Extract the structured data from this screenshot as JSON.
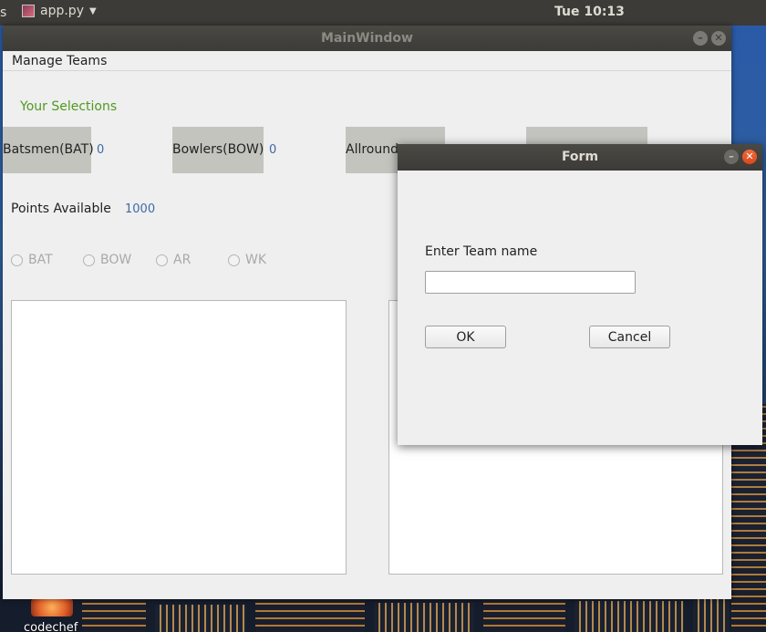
{
  "top_panel": {
    "activities_fragment": "s",
    "app_name": "app.py",
    "clock": "Tue 10:13"
  },
  "desktop": {
    "icon_label": "codechef"
  },
  "main_window": {
    "title": "MainWindow",
    "menu": [
      "Manage Teams"
    ],
    "your_selections_label": "Your Selections",
    "categories": [
      {
        "label": "Batsmen(BAT)",
        "count": "0"
      },
      {
        "label": "Bowlers(BOW)",
        "count": "0"
      },
      {
        "label": "Allround",
        "count": ""
      },
      {
        "label": "",
        "count": ""
      }
    ],
    "points_label": "Points Available",
    "points_value": "1000",
    "radio_options": [
      "BAT",
      "BOW",
      "AR",
      "WK"
    ]
  },
  "form_dialog": {
    "title": "Form",
    "team_name_label": "Enter Team name",
    "team_name_value": "",
    "ok_label": "OK",
    "cancel_label": "Cancel"
  },
  "colors": {
    "selection_green": "#4f9a1f",
    "value_blue": "#3d6aa6",
    "close_orange": "#e2562a",
    "panel_dark": "#3c3b37"
  },
  "icons": [
    "app-icon",
    "dropdown-arrow-icon",
    "minimize-icon",
    "close-icon",
    "radio-icon"
  ]
}
